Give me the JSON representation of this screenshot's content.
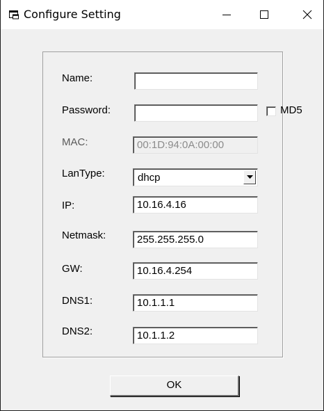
{
  "window": {
    "title": "Configure Setting"
  },
  "form": {
    "name": {
      "label": "Name:",
      "value": ""
    },
    "password": {
      "label": "Password:",
      "value": ""
    },
    "md5": {
      "label": "MD5",
      "checked": false
    },
    "mac": {
      "label": "MAC:",
      "value": "00:1D:94:0A:00:00"
    },
    "lantype": {
      "label": "LanType:",
      "value": "dhcp"
    },
    "ip": {
      "label": "IP:",
      "value": "10.16.4.16"
    },
    "netmask": {
      "label": "Netmask:",
      "value": "255.255.255.0"
    },
    "gw": {
      "label": "GW:",
      "value": "10.16.4.254"
    },
    "dns1": {
      "label": "DNS1:",
      "value": "10.1.1.1"
    },
    "dns2": {
      "label": "DNS2:",
      "value": "10.1.1.2"
    }
  },
  "actions": {
    "ok_label": "OK"
  },
  "icons": {
    "app": "window-app-icon",
    "minimize": "minimize-icon",
    "maximize": "maximize-icon",
    "close": "close-icon",
    "dropdown": "chevron-down-icon"
  },
  "colors": {
    "dialog_bg": "#f0f0f0",
    "titlebar_bg": "#ffffff",
    "field_bg": "#ffffff",
    "disabled_text": "#8c8c8c"
  }
}
